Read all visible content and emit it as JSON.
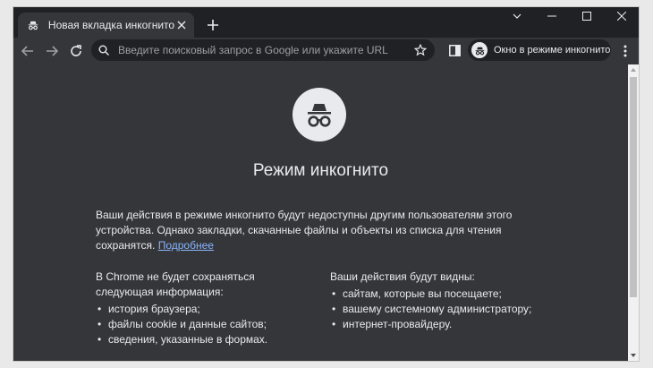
{
  "tab": {
    "title": "Новая вкладка инкогнито"
  },
  "omnibox": {
    "placeholder": "Введите поисковый запрос в Google или укажите URL"
  },
  "incognito_chip": {
    "label": "Окно в режиме инкогнито"
  },
  "page": {
    "heading": "Режим инкогнито",
    "intro": "Ваши действия в режиме инкогнито будут недоступны другим пользователям этого устройства. Однако закладки, скачанные файлы и объекты из списка для чтения сохранятся.",
    "learn_more": "Подробнее",
    "left_title": "В Chrome не будет сохраняться следующая информация:",
    "left_items": [
      "история браузера;",
      "файлы cookie и данные сайтов;",
      "сведения, указанные в формах."
    ],
    "right_title": "Ваши действия будут видны:",
    "right_items": [
      "сайтам, которые вы посещаете;",
      "вашему системному администратору;",
      "интернет-провайдеру."
    ]
  },
  "colors": {
    "frame": "#202124",
    "toolbar": "#35363a",
    "text": "#e8eaed",
    "link": "#8ab4f8",
    "muted": "#9aa0a6"
  },
  "icons": [
    "incognito-icon",
    "close-icon",
    "plus-icon",
    "back-icon",
    "forward-icon",
    "reload-icon",
    "search-icon",
    "star-icon",
    "side-panel-icon",
    "more-icon"
  ]
}
